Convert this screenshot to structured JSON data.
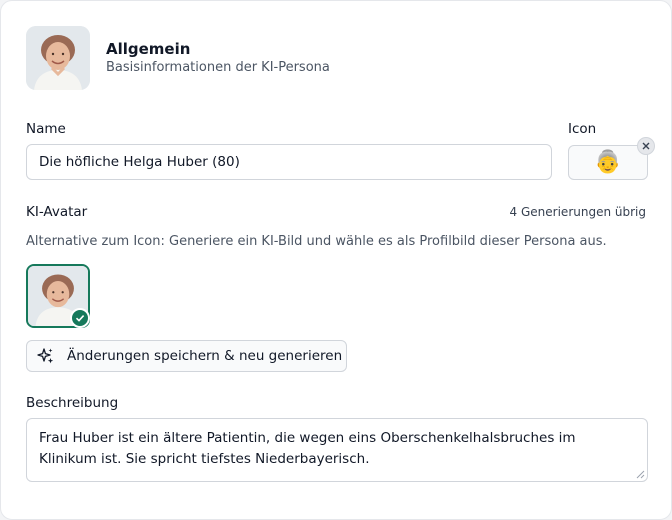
{
  "header": {
    "title": "Allgemein",
    "subtitle": "Basisinformationen der KI-Persona"
  },
  "name_field": {
    "label": "Name",
    "value": "Die höfliche Helga Huber (80)"
  },
  "icon_field": {
    "label": "Icon",
    "emoji": "👵",
    "icon_name": "older-woman-emoji"
  },
  "ki_avatar": {
    "label": "KI-Avatar",
    "generations_left": "4 Generierungen übrig",
    "hint": "Alternative zum Icon: Generiere ein KI-Bild und wähle es als Profilbild dieser Persona aus.",
    "regenerate_button": "Änderungen speichern & neu generieren"
  },
  "description": {
    "label": "Beschreibung",
    "value": "Frau Huber ist ein ältere Patientin, die wegen eins Oberschenkelhalsbruches im Klinikum ist. Sie spricht tiefstes Niederbayerisch."
  },
  "colors": {
    "accent_green": "#16795b",
    "border": "#d1d5db"
  }
}
